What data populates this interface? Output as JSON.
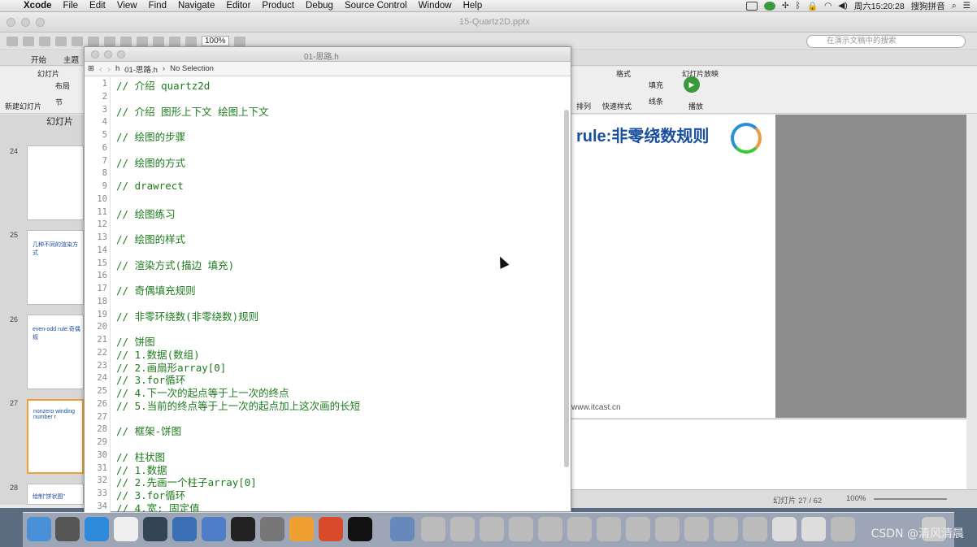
{
  "menubar": {
    "items": [
      "Xcode",
      "File",
      "Edit",
      "View",
      "Find",
      "Navigate",
      "Editor",
      "Product",
      "Debug",
      "Source Control",
      "Window",
      "Help"
    ],
    "clock": "周六15:20:28",
    "ime": "搜狗拼音"
  },
  "ppt": {
    "filename": "15-Quartz2D.pptx",
    "zoom": "100%",
    "search_placeholder": "在演示文稿中的搜索",
    "tabs": [
      "开始",
      "主题"
    ],
    "ribbon_left": {
      "new_slide": "新建幻灯片",
      "layout": "布局",
      "section": "节",
      "group": "幻灯片",
      "thumbs_label": "幻灯片"
    },
    "ribbon_right": {
      "arrange": "排列",
      "quick_styles": "快速样式",
      "fill": "填充",
      "line": "线条",
      "format_group": "格式",
      "slideshow_group": "幻灯片放映",
      "play": "播放"
    },
    "slide_heading": "rule:非零绕数规则",
    "slide_footer": "www.itcast.cn",
    "thumb_numbers": [
      "24",
      "25",
      "26",
      "27",
      "28"
    ],
    "thumb_texts": [
      "几种不同的渲染方式",
      "even-odd rule:奇偶规",
      "nonzero winding number r",
      "绘制\"饼状图\""
    ],
    "status_slide": "幻灯片 27 / 62",
    "status_zoom": "100%"
  },
  "xcode": {
    "window_title": "01-思路.h",
    "jump_file": "01-思路.h",
    "jump_selection": "No Selection",
    "lines": [
      {
        "n": "1",
        "c": "// 介绍 quartz2d"
      },
      {
        "n": "2",
        "c": ""
      },
      {
        "n": "3",
        "c": "// 介绍 图形上下文 绘图上下文"
      },
      {
        "n": "4",
        "c": ""
      },
      {
        "n": "5",
        "c": "// 绘图的步骤"
      },
      {
        "n": "6",
        "c": ""
      },
      {
        "n": "7",
        "c": "// 绘图的方式"
      },
      {
        "n": "8",
        "c": ""
      },
      {
        "n": "9",
        "c": "// drawrect"
      },
      {
        "n": "10",
        "c": ""
      },
      {
        "n": "11",
        "c": "// 绘图练习"
      },
      {
        "n": "12",
        "c": ""
      },
      {
        "n": "13",
        "c": "// 绘图的样式"
      },
      {
        "n": "14",
        "c": ""
      },
      {
        "n": "15",
        "c": "// 渲染方式(描边 填充)"
      },
      {
        "n": "16",
        "c": ""
      },
      {
        "n": "17",
        "c": "// 奇偶填充规则"
      },
      {
        "n": "18",
        "c": ""
      },
      {
        "n": "19",
        "c": "// 非零环绕数(非零绕数)规则"
      },
      {
        "n": "20",
        "c": ""
      },
      {
        "n": "21",
        "c": "// 饼图"
      },
      {
        "n": "22",
        "c": "// 1.数据(数组)"
      },
      {
        "n": "23",
        "c": "// 2.画扇形array[0]"
      },
      {
        "n": "24",
        "c": "// 3.for循环"
      },
      {
        "n": "25",
        "c": "// 4.下一次的起点等于上一次的终点"
      },
      {
        "n": "26",
        "c": "// 5.当前的终点等于上一次的起点加上这次画的长短"
      },
      {
        "n": "27",
        "c": ""
      },
      {
        "n": "28",
        "c": "// 框架-饼图"
      },
      {
        "n": "29",
        "c": ""
      },
      {
        "n": "30",
        "c": "// 柱状图"
      },
      {
        "n": "31",
        "c": "// 1.数据"
      },
      {
        "n": "32",
        "c": "// 2.先画一个柱子array[0]"
      },
      {
        "n": "33",
        "c": "// 3.for循环"
      },
      {
        "n": "34",
        "c": "// 4.宽: 固定值"
      }
    ]
  },
  "watermark": "CSDN @清风清晨",
  "colors": {
    "code_comment": "#1d7b1d",
    "slide_heading": "#1a4fa0"
  }
}
